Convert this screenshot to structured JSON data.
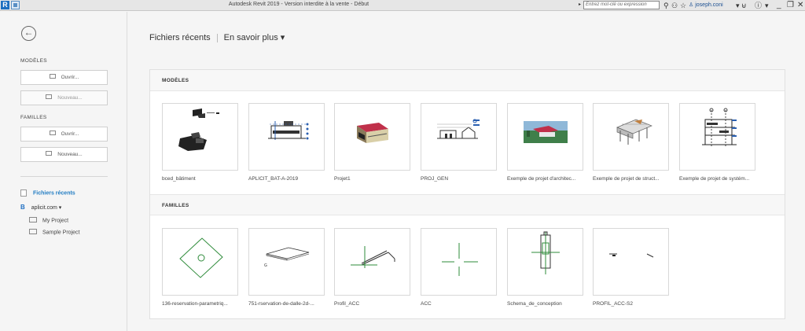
{
  "titlebar": {
    "logo": "R",
    "title": "Autodesk Revit 2019 - Version interdite à la vente - Début",
    "search_placeholder": "Entrez mot-clé ou expression",
    "user": "joseph.coni",
    "icons": [
      "binoculars-icon",
      "network-icon",
      "star-icon",
      "user-icon",
      "cart-icon",
      "help-icon"
    ],
    "window_controls": [
      "minimize-icon",
      "restore-icon",
      "close-icon"
    ]
  },
  "left": {
    "modeles_label": "MODÈLES",
    "open_label": "Ouvrir...",
    "new_label": "Nouveau...",
    "familles_label": "FAMILLES",
    "fam_open_label": "Ouvrir...",
    "fam_new_label": "Nouveau...",
    "recent_label": "Fichiers récents",
    "account_label": "aplicit.com ▾",
    "folders": [
      "My Project",
      "Sample Project"
    ]
  },
  "header": {
    "recent": "Fichiers récents",
    "learn_more": "En savoir plus ▾"
  },
  "sections": {
    "models_title": "MODÈLES",
    "families_title": "FAMILLES"
  },
  "models": [
    {
      "name": "bced_bâtiment"
    },
    {
      "name": "APLICIT_BAT-A-2019"
    },
    {
      "name": "Projet1"
    },
    {
      "name": "PROJ_GEN"
    },
    {
      "name": "Exemple de projet d'architec..."
    },
    {
      "name": "Exemple de projet de struct..."
    },
    {
      "name": "Exemple de projet de systém..."
    }
  ],
  "families": [
    {
      "name": "136-reservation-parametriq..."
    },
    {
      "name": "751-rservation-de-dalle-2d-..."
    },
    {
      "name": "Profil_ACC"
    },
    {
      "name": "ACC"
    },
    {
      "name": "Schema_de_conception"
    },
    {
      "name": "PROFIL_ACC-S2"
    }
  ],
  "colors": {
    "accent": "#1f7bc2",
    "roof_red": "#c0304a",
    "family_green": "#2e8b3a"
  }
}
